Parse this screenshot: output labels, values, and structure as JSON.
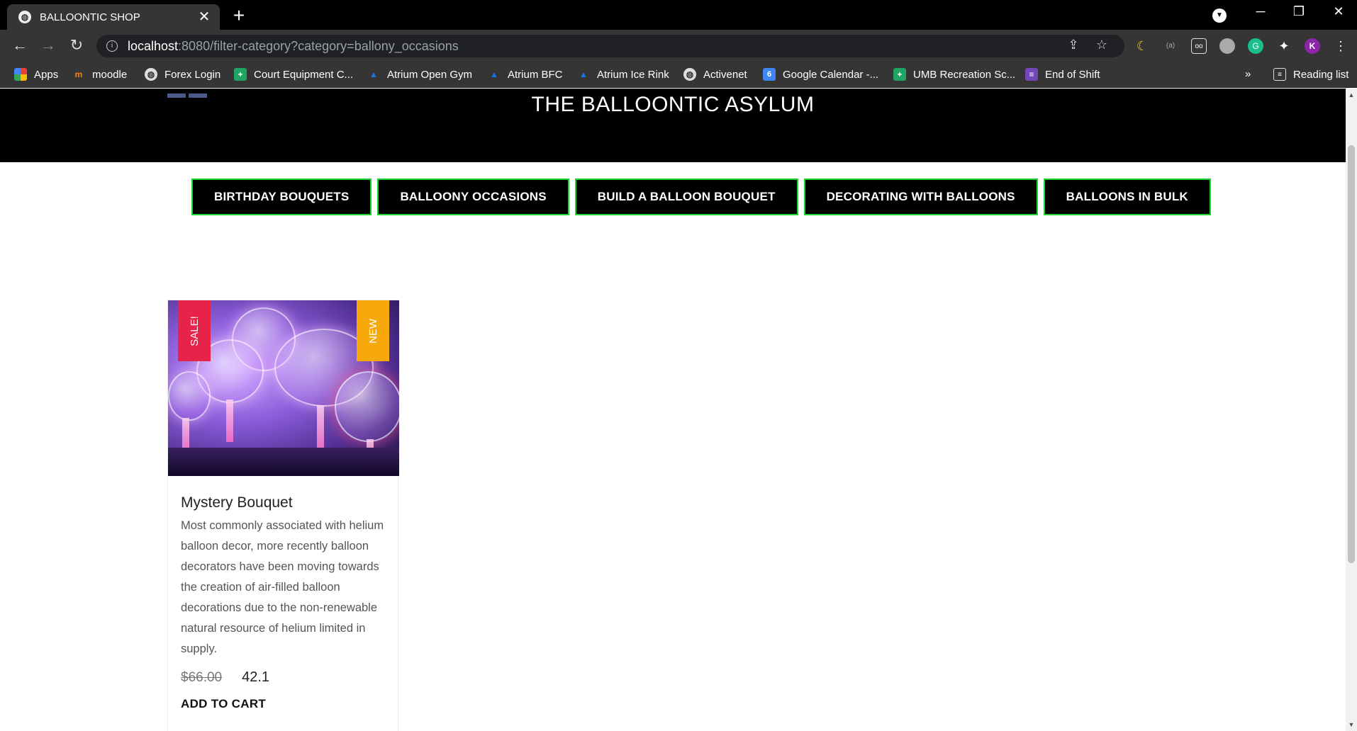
{
  "browser": {
    "tab_title": "BALLOONTIC SHOP",
    "new_tab": "+",
    "url_host": "localhost",
    "url_path": ":8080/filter-category?category=ballony_occasions",
    "profile_initial": "K"
  },
  "bookmarks": [
    {
      "label": "Apps",
      "icon": "apps-grid-icon",
      "color": "#e94235"
    },
    {
      "label": "moodle",
      "icon": "moodle-icon",
      "color": "#f98012"
    },
    {
      "label": "Forex Login",
      "icon": "globe-icon",
      "color": "#ffffff"
    },
    {
      "label": "Court Equipment C...",
      "icon": "sheets-icon",
      "color": "#1fa463"
    },
    {
      "label": "Atrium Open Gym",
      "icon": "activenet-icon",
      "color": "#1a73e8"
    },
    {
      "label": "Atrium BFC",
      "icon": "activenet-icon",
      "color": "#1a73e8"
    },
    {
      "label": "Atrium Ice Rink",
      "icon": "activenet-icon",
      "color": "#1a73e8"
    },
    {
      "label": "Activenet",
      "icon": "globe-icon",
      "color": "#ffffff"
    },
    {
      "label": "Google Calendar -...",
      "icon": "calendar-icon",
      "color": "#4285f4",
      "badge": "6"
    },
    {
      "label": "UMB Recreation Sc...",
      "icon": "sheets-icon",
      "color": "#1fa463"
    },
    {
      "label": "End of Shift",
      "icon": "forms-icon",
      "color": "#7248b9"
    }
  ],
  "bookmarks_more": "»",
  "reading_list": "Reading list",
  "site": {
    "title": "THE BALLOONTIC ASYLUM"
  },
  "categories": [
    "BIRTHDAY BOUQUETS",
    "BALLOONY OCCASIONS",
    "BUILD A BALLOON BOUQUET",
    "DECORATING WITH BALLOONS",
    "BALLOONS IN BULK"
  ],
  "product": {
    "name": "Mystery Bouquet",
    "description": "Most commonly associated with helium balloon decor, more recently balloon decorators have been moving towards the creation of air-filled balloon decorations due to the non-renewable natural resource of helium limited in supply.",
    "old_price": "$66.00",
    "price": "42.1",
    "sale_badge": "SALE!",
    "new_badge": "NEW",
    "add_to_cart": "ADD TO CART"
  },
  "colors": {
    "nav_border": "#1bd62c",
    "sale": "#e8234a",
    "new": "#f7a90c"
  }
}
